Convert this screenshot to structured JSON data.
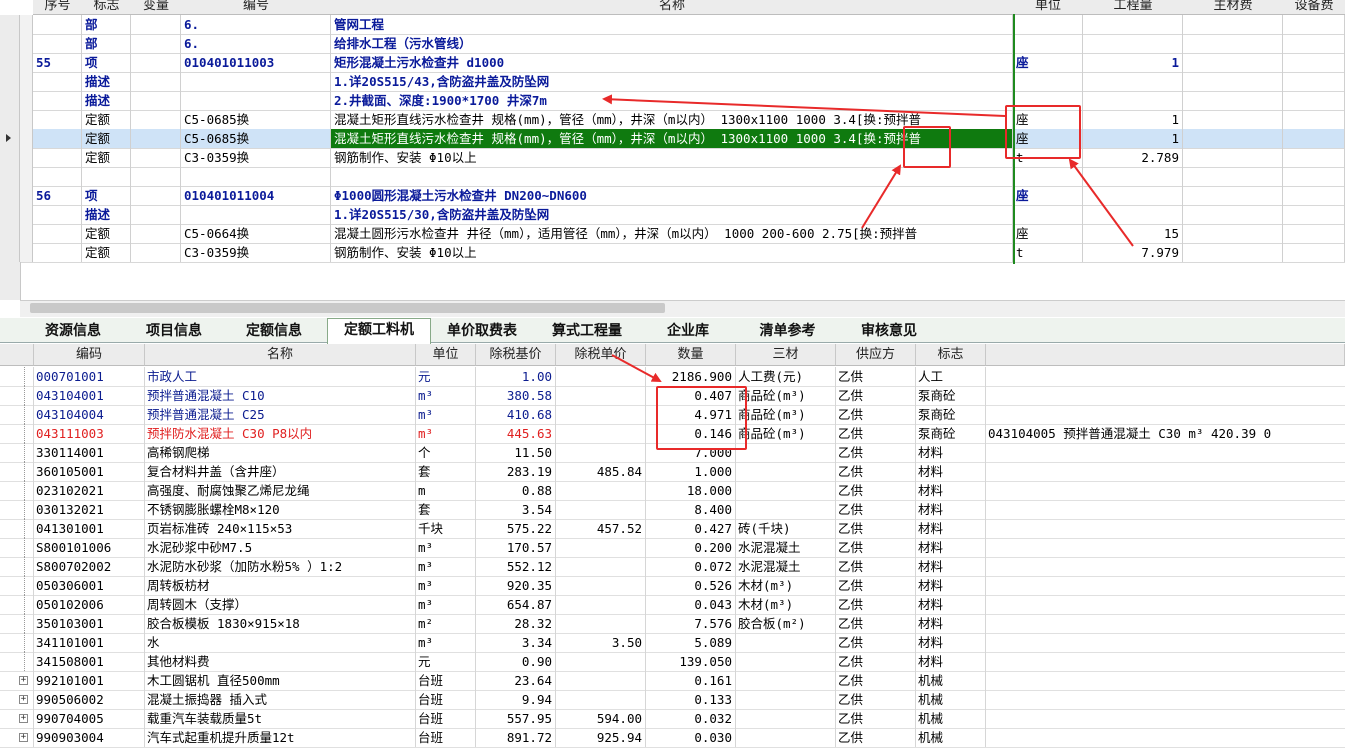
{
  "upper_headers": [
    "序号",
    "标志",
    "变量",
    "编号",
    "名称",
    "单位",
    "工程量",
    "主材费",
    "设备费"
  ],
  "upper_rows": [
    {
      "seq": "",
      "flag": "部",
      "code": "6.",
      "name": "管网工程",
      "unit": "",
      "qty": "",
      "bold": true
    },
    {
      "seq": "",
      "flag": "部",
      "code": "6.",
      "name": "给排水工程（污水管线）",
      "unit": "",
      "qty": "",
      "bold": true
    },
    {
      "seq": "55",
      "flag": "项",
      "code": "010401011003",
      "name": "矩形混凝土污水检查井 d1000",
      "unit": "座",
      "qty": "1",
      "bold": true
    },
    {
      "seq": "",
      "flag": "描述",
      "code": "",
      "name": "1.详20S515/43,含防盗井盖及防坠网",
      "unit": "",
      "qty": "",
      "bold": true
    },
    {
      "seq": "",
      "flag": "描述",
      "code": "",
      "name": "2.井截面、深度:1900*1700 井深7m",
      "unit": "",
      "qty": "",
      "bold": true
    },
    {
      "seq": "",
      "flag": "定额",
      "code": "C5-0685换",
      "name": "混凝土矩形直线污水检查井 规格(mm)，管径（mm），井深（m以内） 1300x1100 1000 3.4[换:预拌普",
      "unit": "座",
      "qty": "1",
      "bold": false
    },
    {
      "seq": "",
      "flag": "定额",
      "code": "C5-0685换",
      "name": "混凝土矩形直线污水检查井 规格(mm)，管径（mm），井深（m以内） 1300x1100 1000 3.4[换:预拌普",
      "unit": "座",
      "qty": "1",
      "bold": false,
      "selected": true
    },
    {
      "seq": "",
      "flag": "定额",
      "code": "C3-0359换",
      "name": "钢筋制作、安装 Φ10以上",
      "unit": "t",
      "qty": "2.789",
      "bold": false
    },
    {
      "seq": "",
      "flag": "",
      "code": "",
      "name": "",
      "unit": "",
      "qty": "",
      "bold": false
    },
    {
      "seq": "56",
      "flag": "项",
      "code": "010401011004",
      "name": "Φ1000圆形混凝土污水检查井 DN200~DN600",
      "unit": "座",
      "qty": "",
      "bold": true
    },
    {
      "seq": "",
      "flag": "描述",
      "code": "",
      "name": "1.详20S515/30,含防盗井盖及防坠网",
      "unit": "",
      "qty": "",
      "bold": true
    },
    {
      "seq": "",
      "flag": "定额",
      "code": "C5-0664换",
      "name": "混凝土圆形污水检查井 井径（mm），适用管径（mm），井深（m以内） 1000 200-600 2.75[换:预拌普",
      "unit": "座",
      "qty": "15",
      "bold": false
    },
    {
      "seq": "",
      "flag": "定额",
      "code": "C3-0359换",
      "name": "钢筋制作、安装 Φ10以上",
      "unit": "t",
      "qty": "7.979",
      "bold": false
    }
  ],
  "tabs": [
    "资源信息",
    "项目信息",
    "定额信息",
    "定额工料机",
    "单价取费表",
    "算式工程量",
    "企业库",
    "清单参考",
    "审核意见"
  ],
  "active_tab": "定额工料机",
  "lower_headers": [
    "编码",
    "名称",
    "单位",
    "除税基价",
    "除税单价",
    "数量",
    "三材",
    "供应方",
    "标志"
  ],
  "lower_rows": [
    {
      "code": "000701001",
      "name": "市政人工",
      "unit": "元",
      "base": "1.00",
      "price": "",
      "qty": "2186.900",
      "mat": "人工费(元)",
      "supplier": "乙供",
      "flag": "人工",
      "color": "navy"
    },
    {
      "code": "043104001",
      "name": "预拌普通混凝土 C10",
      "unit": "m³",
      "base": "380.58",
      "price": "",
      "qty": "0.407",
      "mat": "商品砼(m³)",
      "supplier": "乙供",
      "flag": "泵商砼",
      "color": "navy"
    },
    {
      "code": "043104004",
      "name": "预拌普通混凝土 C25",
      "unit": "m³",
      "base": "410.68",
      "price": "",
      "qty": "4.971",
      "mat": "商品砼(m³)",
      "supplier": "乙供",
      "flag": "泵商砼",
      "color": "navy"
    },
    {
      "code": "043111003",
      "name": "预拌防水混凝土 C30 P8以内",
      "unit": "m³",
      "base": "445.63",
      "price": "",
      "qty": "0.146",
      "mat": "商品砼(m³)",
      "supplier": "乙供",
      "flag": "泵商砼",
      "color": "red",
      "extra": "043104005  预拌普通混凝土 C30  m³  420.39  0"
    },
    {
      "code": "330114001",
      "name": "高稀钢爬梯",
      "unit": "个",
      "base": "11.50",
      "price": "",
      "qty": "7.000",
      "mat": "",
      "supplier": "乙供",
      "flag": "材料"
    },
    {
      "code": "360105001",
      "name": "复合材料井盖（含井座）",
      "unit": "套",
      "base": "283.19",
      "price": "485.84",
      "qty": "1.000",
      "mat": "",
      "supplier": "乙供",
      "flag": "材料"
    },
    {
      "code": "023102021",
      "name": "高强度、耐腐蚀聚乙烯尼龙绳",
      "unit": "m",
      "base": "0.88",
      "price": "",
      "qty": "18.000",
      "mat": "",
      "supplier": "乙供",
      "flag": "材料"
    },
    {
      "code": "030132021",
      "name": "不锈钢膨胀螺栓M8×120",
      "unit": "套",
      "base": "3.54",
      "price": "",
      "qty": "8.400",
      "mat": "",
      "supplier": "乙供",
      "flag": "材料"
    },
    {
      "code": "041301001",
      "name": "页岩标准砖 240×115×53",
      "unit": "千块",
      "base": "575.22",
      "price": "457.52",
      "qty": "0.427",
      "mat": "砖(千块)",
      "supplier": "乙供",
      "flag": "材料"
    },
    {
      "code": "S800101006",
      "name": "水泥砂浆中砂M7.5",
      "unit": "m³",
      "base": "170.57",
      "price": "",
      "qty": "0.200",
      "mat": "水泥混凝土",
      "supplier": "乙供",
      "flag": "材料"
    },
    {
      "code": "S800702002",
      "name": "水泥防水砂浆（加防水粉5% ）1:2",
      "unit": "m³",
      "base": "552.12",
      "price": "",
      "qty": "0.072",
      "mat": "水泥混凝土",
      "supplier": "乙供",
      "flag": "材料"
    },
    {
      "code": "050306001",
      "name": "周转板枋材",
      "unit": "m³",
      "base": "920.35",
      "price": "",
      "qty": "0.526",
      "mat": "木材(m³)",
      "supplier": "乙供",
      "flag": "材料"
    },
    {
      "code": "050102006",
      "name": "周转圆木（支撑）",
      "unit": "m³",
      "base": "654.87",
      "price": "",
      "qty": "0.043",
      "mat": "木材(m³)",
      "supplier": "乙供",
      "flag": "材料"
    },
    {
      "code": "350103001",
      "name": "胶合板模板 1830×915×18",
      "unit": "m²",
      "base": "28.32",
      "price": "",
      "qty": "7.576",
      "mat": "胶合板(m²)",
      "supplier": "乙供",
      "flag": "材料"
    },
    {
      "code": "341101001",
      "name": "水",
      "unit": "m³",
      "base": "3.34",
      "price": "3.50",
      "qty": "5.089",
      "mat": "",
      "supplier": "乙供",
      "flag": "材料"
    },
    {
      "code": "341508001",
      "name": "其他材料费",
      "unit": "元",
      "base": "0.90",
      "price": "",
      "qty": "139.050",
      "mat": "",
      "supplier": "乙供",
      "flag": "材料"
    },
    {
      "code": "992101001",
      "name": "木工圆锯机 直径500mm",
      "unit": "台班",
      "base": "23.64",
      "price": "",
      "qty": "0.161",
      "mat": "",
      "supplier": "乙供",
      "flag": "机械",
      "expand": true
    },
    {
      "code": "990506002",
      "name": "混凝土振捣器 插入式",
      "unit": "台班",
      "base": "9.94",
      "price": "",
      "qty": "0.133",
      "mat": "",
      "supplier": "乙供",
      "flag": "机械",
      "expand": true
    },
    {
      "code": "990704005",
      "name": "载重汽车装载质量5t",
      "unit": "台班",
      "base": "557.95",
      "price": "594.00",
      "qty": "0.032",
      "mat": "",
      "supplier": "乙供",
      "flag": "机械",
      "expand": true
    },
    {
      "code": "990903004",
      "name": "汽车式起重机提升质量12t",
      "unit": "台班",
      "base": "891.72",
      "price": "925.94",
      "qty": "0.030",
      "mat": "",
      "supplier": "乙供",
      "flag": "机械",
      "expand": true
    }
  ],
  "colors": {
    "selected_row": "#cfe3f7",
    "highlight_green": "#0f7a0f",
    "annotation_red": "#e82a2a",
    "header_blue": "#0a1a9a"
  }
}
